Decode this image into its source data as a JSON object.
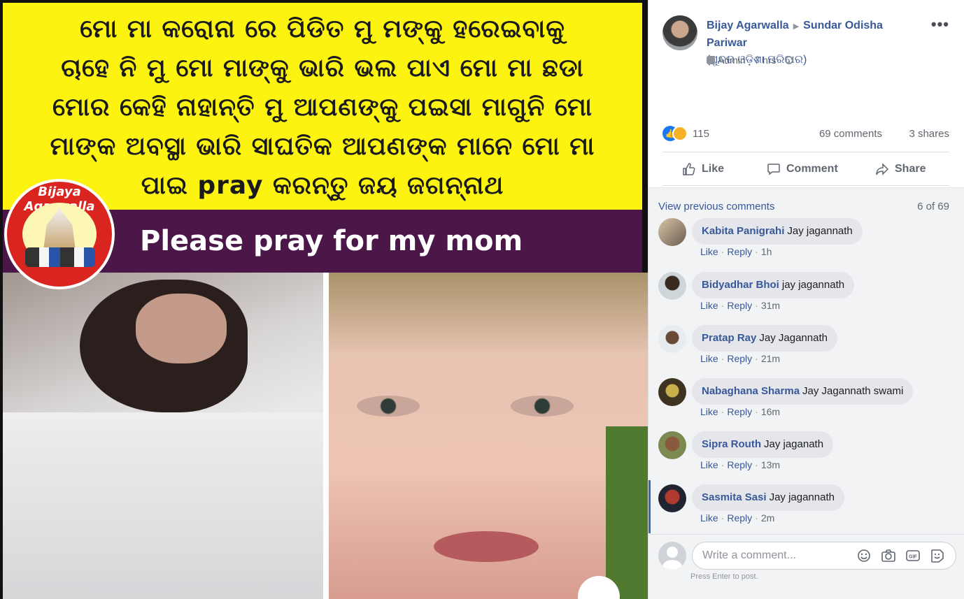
{
  "image": {
    "odia_lines": [
      "ମୋ ମା କରୋନା ରେ ପିଡିତ ମୁ ମଙ୍କୁ ହରେଇବାକୁ",
      "ଚାହେ ନି ମୁ ମୋ ମାଙ୍କୁ ଭାରି ଭଲ ପାଏ ମୋ ମା ଛଡା",
      "ମୋର କେହି ନାହାନ୍ତି ମୁ ଆପଣଙ୍କୁ ପଇସା ମାଗୁନି ମୋ",
      "ମାଙ୍କ ଅବସ୍ଥା ଭାରି ସାଘତିକ ଆପଣଙ୍କ ମାନେ ମୋ ମା",
      "ପାଇ pray କରନ୍ତୁ ଜୟ ଜଗନ୍ନାଥ"
    ],
    "english_caption": "Please pray for my mom",
    "badge_text": "Bijaya Agarwalla",
    "colors": {
      "banner": "#fcf311",
      "caption_bg": "#4a1748",
      "badge": "#d9241f"
    }
  },
  "post": {
    "author": "Bijay Agarwalla",
    "group": "Sundar Odisha Pariwar",
    "group_native": "(ସୁନ୍ଦର ଓଡ଼ିଶା ପରିବାର)",
    "role": "Admin",
    "time": "7 hrs",
    "more_glyph": "•••",
    "reactions_count": "115",
    "comments_count": "69 comments",
    "shares_count": "3 shares",
    "actions": {
      "like": "Like",
      "comment": "Comment",
      "share": "Share"
    }
  },
  "comments": {
    "view_previous": "View previous comments",
    "page_count": "6 of 69",
    "like_label": "Like",
    "reply_label": "Reply",
    "items": [
      {
        "author": "Kabita Panigrahi",
        "text": "Jay jagannath",
        "time": "1h"
      },
      {
        "author": "Bidyadhar Bhoi",
        "text": "jay jagannath",
        "time": "31m"
      },
      {
        "author": "Pratap Ray",
        "text": "Jay Jagannath",
        "time": "21m"
      },
      {
        "author": "Nabaghana Sharma",
        "text": "Jay Jagannath swami",
        "time": "16m"
      },
      {
        "author": "Sipra Routh",
        "text": "Jay jaganath",
        "time": "13m"
      },
      {
        "author": "Sasmita Sasi",
        "text": "Jay jagannath",
        "time": "2m"
      }
    ]
  },
  "composer": {
    "placeholder": "Write a comment...",
    "hint": "Press Enter to post.",
    "gif_label": "GIF"
  }
}
